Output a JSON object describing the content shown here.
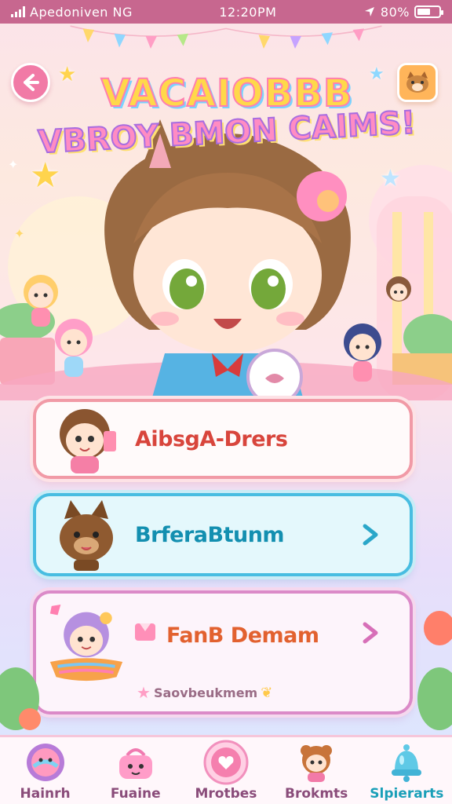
{
  "status_bar": {
    "carrier": "Apedoniven NG",
    "time": "12:20PM",
    "battery": "80%"
  },
  "header": {
    "title_line1": "VACAIOBBB",
    "title_line2": "VBROY BMON CAIMS!"
  },
  "menu": {
    "items": [
      {
        "label": "AibsgA-Drers",
        "icon": "girl-avatar-icon",
        "has_chevron": false
      },
      {
        "label": "BrferaBtunm",
        "icon": "cat-avatar-icon",
        "has_chevron": true
      },
      {
        "label": "FanB Demam",
        "icon": "purple-girl-avatar-icon",
        "has_chevron": true,
        "sub_label": "Saovbeukmem"
      }
    ]
  },
  "bottom_nav": {
    "items": [
      {
        "label": "Hainrh",
        "icon": "planet-icon"
      },
      {
        "label": "Fuaine",
        "icon": "basket-icon"
      },
      {
        "label": "Mrotbes",
        "icon": "heart-badge-icon"
      },
      {
        "label": "Brokmts",
        "icon": "bear-girl-icon"
      },
      {
        "label": "Slpierarts",
        "icon": "bell-icon"
      }
    ],
    "active_index": 4
  },
  "colors": {
    "status_bar": "#c7678f",
    "accent_pink": "#f17aa6",
    "accent_blue": "#48bde1",
    "accent_purple": "#db8ac8"
  }
}
